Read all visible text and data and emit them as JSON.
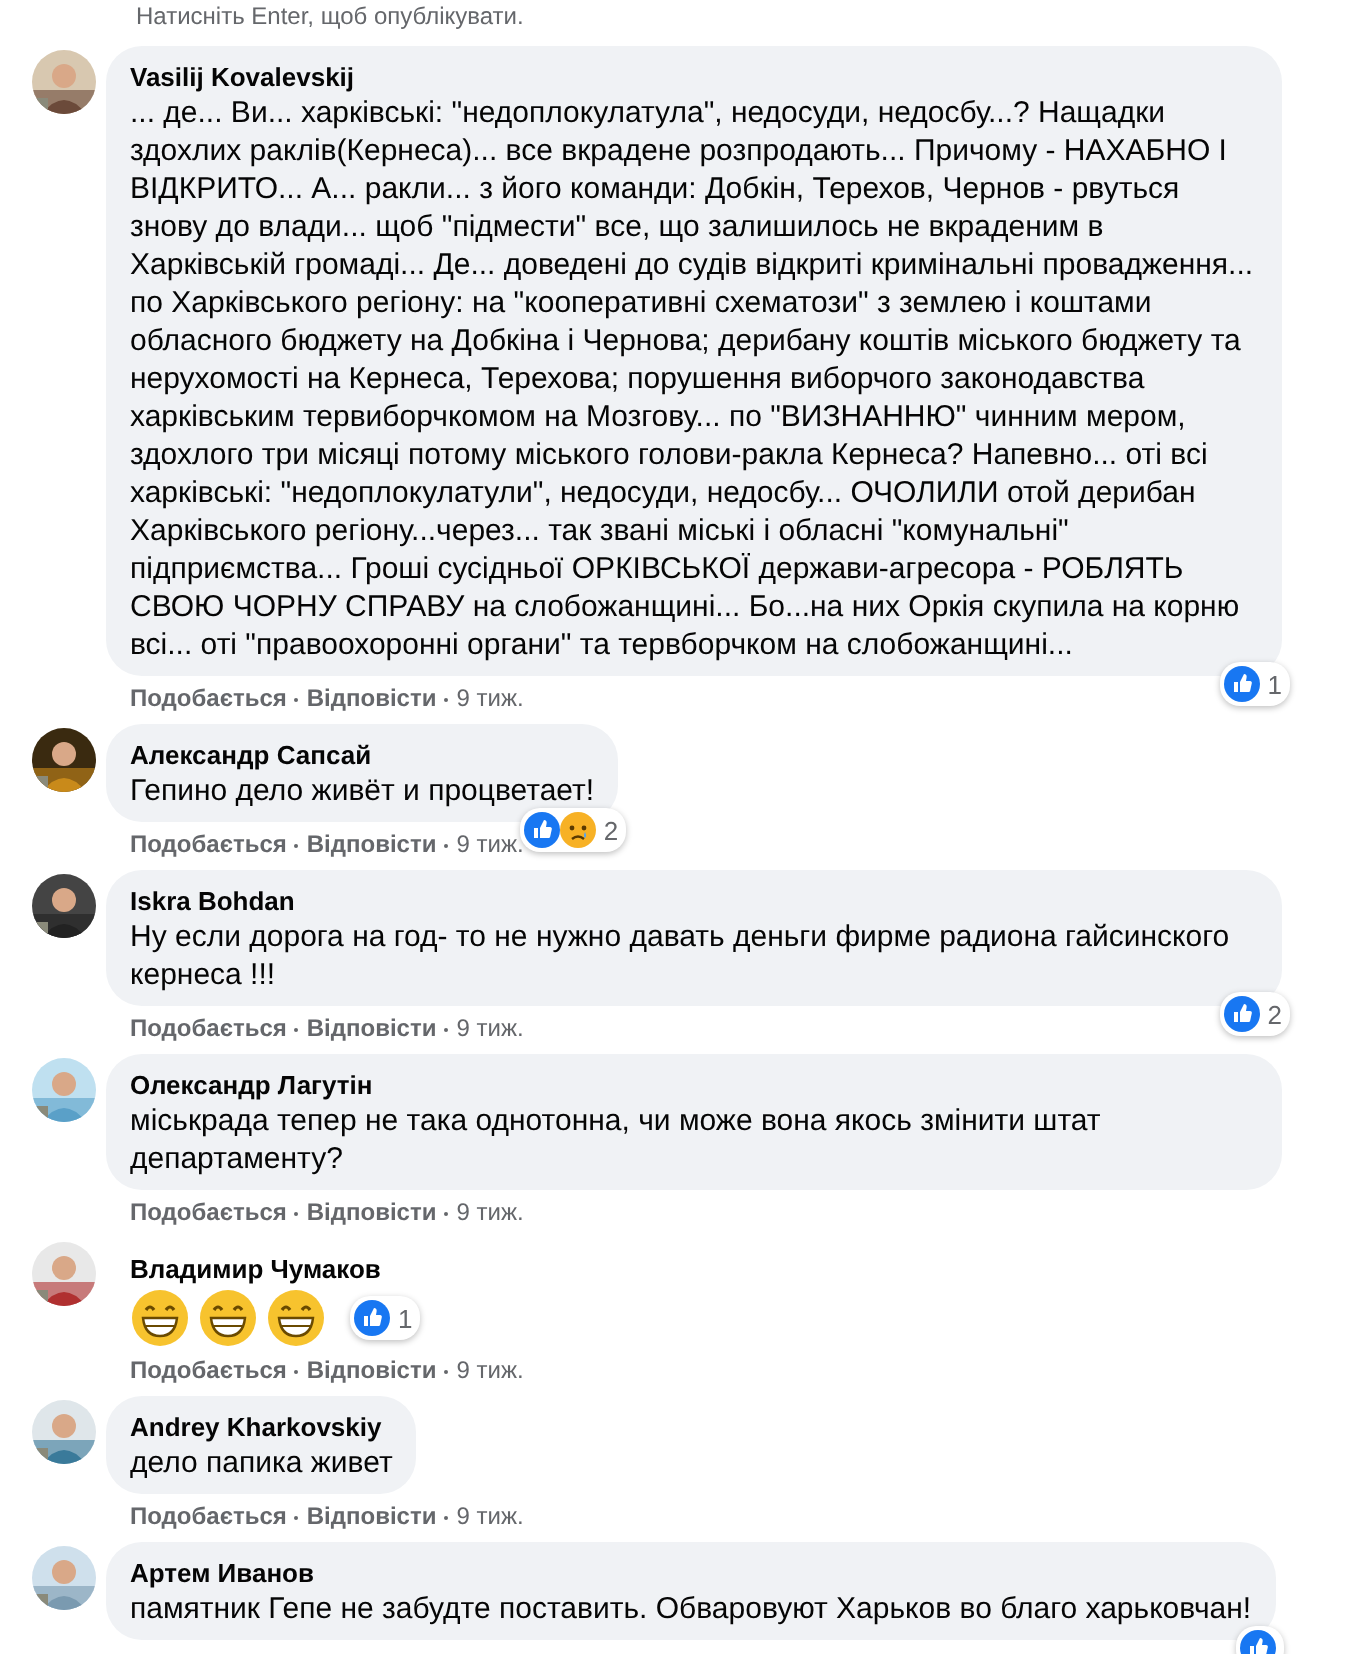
{
  "hint": "Натисніть Enter, щоб опублікувати.",
  "comments": [
    {
      "kind": "text",
      "author": "Vasilij Kovalevskij",
      "text": "... де... Ви... харківські: \"недоплокулатула\", недосуди, недосбу...? Нащадки здохлих раклів(Кернеса)... все вкрадене розпродають... Причому - НАХАБНО І ВІДКРИТО... А... ракли... з його команди: Добкін, Терехов, Чернов - рвуться знову до влади... щоб \"підмести\" все, що залишилось не вкраденим в Харківській громаді... Де... доведені до судів відкриті кримінальні провадження... по Харківського регіону: на \"кооперативні схематози\" з землею і коштами обласного бюджету на Добкіна і Чернова; дерибану коштів міського бюджету та нерухомості на Кернеса, Терехова; порушення виборчого законодавства харківським тервиборчкомом на Мозгову... по \"ВИЗНАННЮ\" чинним мером, здохлого три місяці потому міського голови-ракла Кернеса? Напевно... оті всі харківські: \"недоплокулатули\", недосуди, недосбу... ОЧОЛИЛИ отой дерибан Харківського регіону...через... так звані міські і обласні \"комунальні\" підприємства... Гроші сусідньої ОРКІВСЬКОЇ держави-агресора - РОБЛЯТЬ СВОЮ ЧОРНУ СПРАВУ на слобожанщині... Бо...на них Оркія скупила на корню всі... оті \"правоохоронні органи\" та тервборчком на слобожанщині...",
      "reactions": {
        "icons": [
          {
            "kind": "like"
          }
        ],
        "count": "1"
      },
      "like": "Подобається",
      "reply": "Відповісти",
      "time": "9 тиж."
    },
    {
      "kind": "text",
      "author": "Александр Сапсай",
      "text": "Гепино дело живёт и процветает!",
      "reactions": {
        "icons": [
          {
            "kind": "like"
          },
          {
            "kind": "sad"
          }
        ],
        "count": "2"
      },
      "like": "Подобається",
      "reply": "Відповісти",
      "time": "9 тиж."
    },
    {
      "kind": "text",
      "author": "Iskra Bohdan",
      "text": "Ну если дорога на год- то не нужно давать деньги фирме радиона гайсинского кернеса !!!",
      "reactions": {
        "icons": [
          {
            "kind": "like"
          }
        ],
        "count": "2"
      },
      "like": "Подобається",
      "reply": "Відповісти",
      "time": "9 тиж."
    },
    {
      "kind": "text",
      "author": "Олександр Лагутін",
      "text": "міськрада тепер не така однотонна, чи може вона якось змінити штат департаменту?",
      "like": "Подобається",
      "reply": "Відповісти",
      "time": "9 тиж."
    },
    {
      "kind": "emoji",
      "author": "Владимир Чумаков",
      "emojis": [
        {
          "kind": "grin"
        },
        {
          "kind": "grin"
        },
        {
          "kind": "grin"
        }
      ],
      "reactions": {
        "icons": [
          {
            "kind": "like"
          }
        ],
        "count": "1"
      },
      "like": "Подобається",
      "reply": "Відповісти",
      "time": "9 тиж."
    },
    {
      "kind": "text",
      "author": "Andrey Kharkovskiy",
      "text": "дело папика живет",
      "like": "Подобається",
      "reply": "Відповісти",
      "time": "9 тиж."
    },
    {
      "kind": "text",
      "author": "Артем Иванов",
      "text": "памятник Гепе не забудте поставить. Обваровуют Харьков во благо харьковчан!",
      "reactions": {
        "icons": [
          {
            "kind": "like"
          }
        ]
      }
    }
  ]
}
